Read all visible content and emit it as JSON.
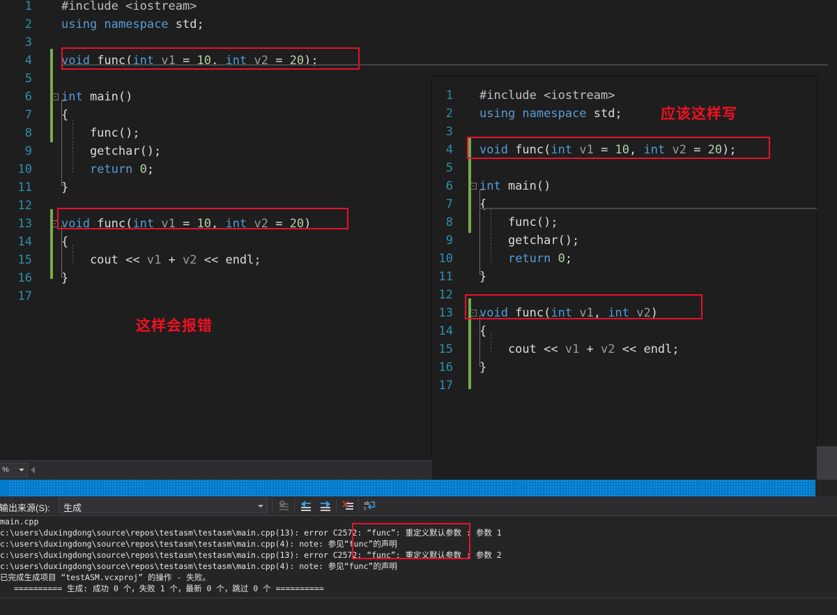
{
  "left_editor": {
    "name": "left-code-editor",
    "lines": [
      {
        "n": "1",
        "tokens": [
          {
            "t": "#include ",
            "c": "pre"
          },
          {
            "t": "<iostream>",
            "c": "pre"
          }
        ]
      },
      {
        "n": "2",
        "tokens": [
          {
            "t": "using ",
            "c": "kw"
          },
          {
            "t": "namespace ",
            "c": "kw"
          },
          {
            "t": "std",
            "c": "id"
          },
          {
            "t": ";",
            "c": "plain"
          }
        ]
      },
      {
        "n": "3",
        "tokens": []
      },
      {
        "n": "4",
        "tokens": [
          {
            "t": "void ",
            "c": "kw"
          },
          {
            "t": "func",
            "c": "id"
          },
          {
            "t": "(",
            "c": "plain"
          },
          {
            "t": "int ",
            "c": "kw"
          },
          {
            "t": "v1",
            "c": "var"
          },
          {
            "t": " = ",
            "c": "plain"
          },
          {
            "t": "10",
            "c": "num"
          },
          {
            "t": ", ",
            "c": "plain"
          },
          {
            "t": "int ",
            "c": "kw"
          },
          {
            "t": "v2",
            "c": "var"
          },
          {
            "t": " = ",
            "c": "plain"
          },
          {
            "t": "20",
            "c": "num"
          },
          {
            "t": ");",
            "c": "plain"
          }
        ]
      },
      {
        "n": "5",
        "tokens": []
      },
      {
        "n": "6",
        "tokens": [
          {
            "t": "int ",
            "c": "kw"
          },
          {
            "t": "main",
            "c": "id"
          },
          {
            "t": "()",
            "c": "plain"
          }
        ]
      },
      {
        "n": "7",
        "tokens": [
          {
            "t": "{",
            "c": "plain"
          }
        ]
      },
      {
        "n": "8",
        "tokens": [
          {
            "t": "    func();",
            "c": "plain"
          }
        ]
      },
      {
        "n": "9",
        "tokens": [
          {
            "t": "    getchar();",
            "c": "plain"
          }
        ]
      },
      {
        "n": "10",
        "tokens": [
          {
            "t": "    ",
            "c": "plain"
          },
          {
            "t": "return ",
            "c": "kw"
          },
          {
            "t": "0",
            "c": "num"
          },
          {
            "t": ";",
            "c": "plain"
          }
        ]
      },
      {
        "n": "11",
        "tokens": [
          {
            "t": "}",
            "c": "plain"
          }
        ]
      },
      {
        "n": "12",
        "tokens": []
      },
      {
        "n": "13",
        "tokens": [
          {
            "t": "void ",
            "c": "kw"
          },
          {
            "t": "func",
            "c": "id"
          },
          {
            "t": "(",
            "c": "plain"
          },
          {
            "t": "int ",
            "c": "kw"
          },
          {
            "t": "v1",
            "c": "var"
          },
          {
            "t": " = ",
            "c": "plain"
          },
          {
            "t": "10",
            "c": "num"
          },
          {
            "t": ", ",
            "c": "plain"
          },
          {
            "t": "int ",
            "c": "kw"
          },
          {
            "t": "v2",
            "c": "var"
          },
          {
            "t": " = ",
            "c": "plain"
          },
          {
            "t": "20",
            "c": "num"
          },
          {
            "t": ")",
            "c": "plain"
          }
        ]
      },
      {
        "n": "14",
        "tokens": [
          {
            "t": "{",
            "c": "plain"
          }
        ]
      },
      {
        "n": "15",
        "tokens": [
          {
            "t": "    cout << ",
            "c": "plain"
          },
          {
            "t": "v1",
            "c": "var"
          },
          {
            "t": " + ",
            "c": "plain"
          },
          {
            "t": "v2",
            "c": "var"
          },
          {
            "t": " << endl;",
            "c": "plain"
          }
        ]
      },
      {
        "n": "16",
        "tokens": [
          {
            "t": "}",
            "c": "plain"
          }
        ]
      },
      {
        "n": "17",
        "tokens": []
      }
    ],
    "annotation": "这样会报错"
  },
  "right_editor": {
    "name": "right-code-editor",
    "lines": [
      {
        "n": "1",
        "tokens": [
          {
            "t": "#include ",
            "c": "pre"
          },
          {
            "t": "<iostream>",
            "c": "pre"
          }
        ]
      },
      {
        "n": "2",
        "tokens": [
          {
            "t": "using ",
            "c": "kw"
          },
          {
            "t": "namespace ",
            "c": "kw"
          },
          {
            "t": "std",
            "c": "id"
          },
          {
            "t": ";",
            "c": "plain"
          }
        ]
      },
      {
        "n": "3",
        "tokens": []
      },
      {
        "n": "4",
        "tokens": [
          {
            "t": "void ",
            "c": "kw"
          },
          {
            "t": "func",
            "c": "id"
          },
          {
            "t": "(",
            "c": "plain"
          },
          {
            "t": "int ",
            "c": "kw"
          },
          {
            "t": "v1",
            "c": "var"
          },
          {
            "t": " = ",
            "c": "plain"
          },
          {
            "t": "10",
            "c": "num"
          },
          {
            "t": ", ",
            "c": "plain"
          },
          {
            "t": "int ",
            "c": "kw"
          },
          {
            "t": "v2",
            "c": "var"
          },
          {
            "t": " = ",
            "c": "plain"
          },
          {
            "t": "20",
            "c": "num"
          },
          {
            "t": ");",
            "c": "plain"
          }
        ]
      },
      {
        "n": "5",
        "tokens": []
      },
      {
        "n": "6",
        "tokens": [
          {
            "t": "int ",
            "c": "kw"
          },
          {
            "t": "main",
            "c": "id"
          },
          {
            "t": "()",
            "c": "plain"
          }
        ]
      },
      {
        "n": "7",
        "tokens": [
          {
            "t": "{",
            "c": "plain"
          }
        ]
      },
      {
        "n": "8",
        "tokens": [
          {
            "t": "    func();",
            "c": "plain"
          }
        ]
      },
      {
        "n": "9",
        "tokens": [
          {
            "t": "    getchar();",
            "c": "plain"
          }
        ]
      },
      {
        "n": "10",
        "tokens": [
          {
            "t": "    ",
            "c": "plain"
          },
          {
            "t": "return ",
            "c": "kw"
          },
          {
            "t": "0",
            "c": "num"
          },
          {
            "t": ";",
            "c": "plain"
          }
        ]
      },
      {
        "n": "11",
        "tokens": [
          {
            "t": "}",
            "c": "plain"
          }
        ]
      },
      {
        "n": "12",
        "tokens": []
      },
      {
        "n": "13",
        "tokens": [
          {
            "t": "void ",
            "c": "kw"
          },
          {
            "t": "func",
            "c": "id"
          },
          {
            "t": "(",
            "c": "plain"
          },
          {
            "t": "int ",
            "c": "kw"
          },
          {
            "t": "v1",
            "c": "var"
          },
          {
            "t": ", ",
            "c": "plain"
          },
          {
            "t": "int ",
            "c": "kw"
          },
          {
            "t": "v2",
            "c": "var"
          },
          {
            "t": ")",
            "c": "plain"
          }
        ]
      },
      {
        "n": "14",
        "tokens": [
          {
            "t": "{",
            "c": "plain"
          }
        ]
      },
      {
        "n": "15",
        "tokens": [
          {
            "t": "    cout << ",
            "c": "plain"
          },
          {
            "t": "v1",
            "c": "var"
          },
          {
            "t": " + ",
            "c": "plain"
          },
          {
            "t": "v2",
            "c": "var"
          },
          {
            "t": " << endl;",
            "c": "plain"
          }
        ]
      },
      {
        "n": "16",
        "tokens": [
          {
            "t": "}",
            "c": "plain"
          }
        ]
      },
      {
        "n": "17",
        "tokens": []
      }
    ],
    "annotation": "应该这样写"
  },
  "zoom_strip": {
    "zoom_value": "%",
    "scroll_left_icon": "triangle-left-icon"
  },
  "output_pane": {
    "title": "出",
    "source_label": "示输出来源(S):",
    "source_value": "生成",
    "toolbar_buttons": [
      {
        "name": "find-message-button",
        "glyph": "find-msg-icon"
      },
      {
        "name": "go-to-previous-message-button",
        "glyph": "prev-msg-icon"
      },
      {
        "name": "go-to-next-message-button",
        "glyph": "next-msg-icon"
      },
      {
        "name": "clear-all-button",
        "glyph": "clear-all-icon"
      },
      {
        "name": "toggle-word-wrap-button",
        "glyph": "word-wrap-icon"
      }
    ],
    "lines": [
      {
        "text": "main.cpp",
        "indent": 0
      },
      {
        "text": "c:\\users\\duxingdong\\source\\repos\\testasm\\testasm\\main.cpp(13): error C2572: “func”: 重定义默认参数 : 参数 1",
        "indent": 0
      },
      {
        "text": "c:\\users\\duxingdong\\source\\repos\\testasm\\testasm\\main.cpp(4): note: 参见“func”的声明",
        "indent": 0
      },
      {
        "text": "c:\\users\\duxingdong\\source\\repos\\testasm\\testasm\\main.cpp(13): error C2572: “func”: 重定义默认参数 : 参数 2",
        "indent": 0
      },
      {
        "text": "c:\\users\\duxingdong\\source\\repos\\testasm\\testasm\\main.cpp(4): note: 参见“func”的声明",
        "indent": 0
      },
      {
        "text": "已完成生成项目 “testASM.vcxproj” 的操作 - 失败。",
        "indent": 0
      },
      {
        "text": "========== 生成: 成功 0 个，失败 1 个，最新 0 个，跳过 0 个 ==========",
        "indent": 30
      }
    ]
  },
  "colors": {
    "annotation_red": "#ee1122",
    "box_red": "#e8112d",
    "keyword_blue": "#569cd6",
    "number_green": "#b5cea8",
    "line_number": "#2b91af",
    "editor_bg": "#1e1e1e",
    "titlebar_blue": "#007acc",
    "change_bar_green": "#7aa84f"
  }
}
